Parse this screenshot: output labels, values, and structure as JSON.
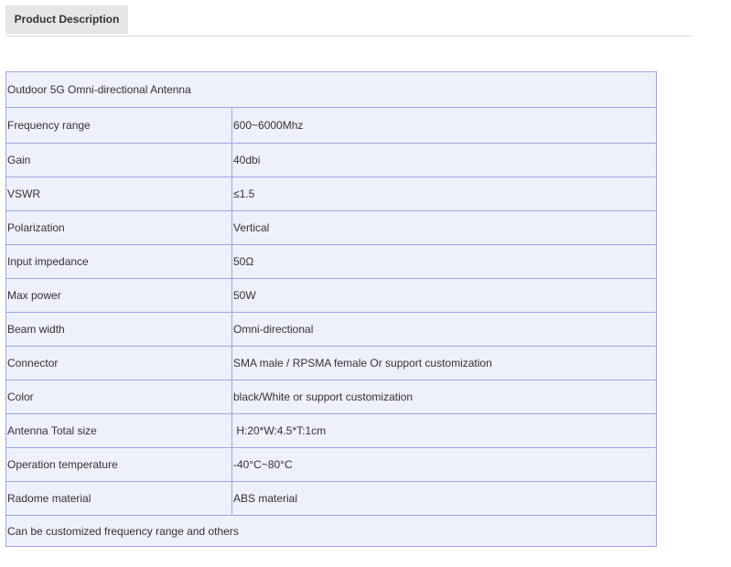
{
  "tabs": {
    "active_label": "Product Description"
  },
  "table": {
    "title": "Outdoor 5G Omni-directional Antenna",
    "rows": [
      {
        "label": "Frequency range",
        "value": "600~6000Mhz"
      },
      {
        "label": "Gain",
        "value": "40dbi"
      },
      {
        "label": "VSWR",
        "value": "≤1.5"
      },
      {
        "label": "Polarization",
        "value": "Vertical"
      },
      {
        "label": "Input impedance",
        "value": "50Ω"
      },
      {
        "label": "Max power",
        "value": "50W"
      },
      {
        "label": "Beam width",
        "value": "Omni-directional"
      },
      {
        "label": "Connector",
        "value": "SMA male / RPSMA female Or support customization"
      },
      {
        "label": "Color",
        "value": "black/White or support customization"
      },
      {
        "label": "Antenna Total size",
        "value": " H:20*W:4.5*T:1cm"
      },
      {
        "label": "Operation temperature",
        "value": "-40°C~80°C"
      },
      {
        "label": "Radome material",
        "value": "ABS material"
      }
    ],
    "footer": "Can be customized frequency range and others"
  }
}
